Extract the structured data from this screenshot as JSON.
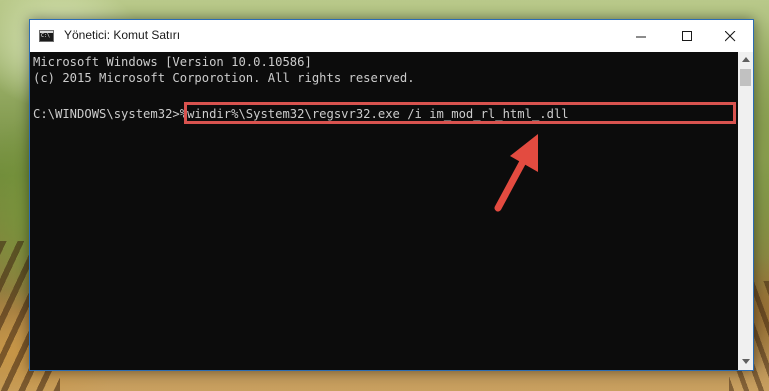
{
  "window": {
    "title": "Yönetici: Komut Satırı",
    "icon": "cmd-icon",
    "controls": {
      "minimize_icon": "minimize-icon",
      "maximize_icon": "maximize-icon",
      "close_icon": "close-icon"
    }
  },
  "console": {
    "lines": [
      "Microsoft Windows [Version 10.0.10586]",
      "(c) 2015 Microsoft Corporotion. All rights reserved."
    ],
    "prompt": "C:\\WINDOWS\\system32>",
    "command": "%windir%\\System32\\regsvr32.exe /i im_mod_rl_html_.dll"
  },
  "annotation": {
    "highlight_color": "#d9534f",
    "arrow_icon": "arrow-pointer-icon"
  },
  "scrollbar": {
    "up_icon": "scroll-up-arrow-icon",
    "down_icon": "scroll-down-arrow-icon"
  }
}
